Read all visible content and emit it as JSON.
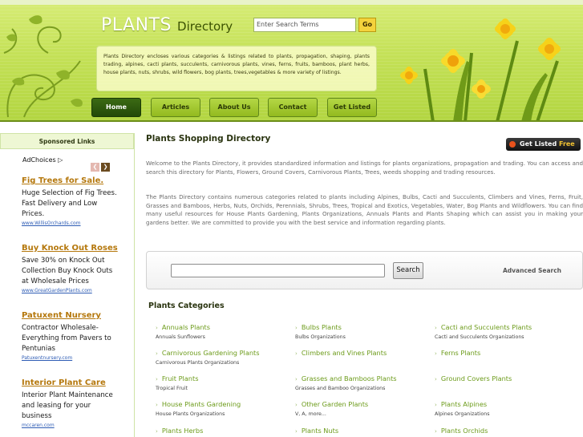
{
  "header": {
    "logo_main": "PLANTS",
    "logo_sub": "Directory",
    "search_placeholder": "Enter Search Terms",
    "search_go": "Go",
    "intro": "Plants Directory encloses various categories & listings related to plants, propagation, shaping, plants trading, alpines, cacti plants, succulents, carnivorous plants, vines, ferns, fruits, bamboos, plant herbs, house plants, nuts, shrubs, wild flowers, bog plants, trees,vegetables & more variety of listings.",
    "nav": [
      "Home",
      "Articles",
      "About Us",
      "Contact",
      "Get Listed"
    ]
  },
  "sidebar": {
    "title": "Sponsored Links",
    "adchoices": "AdChoices ▷",
    "ads": [
      {
        "title": "Fig Trees for Sale.",
        "body": "Huge Selection of Fig Trees. Fast Delivery and Low Prices.",
        "url": "www.WillisOrchards.com"
      },
      {
        "title": "Buy Knock Out Roses",
        "body": "Save 30% on Knock Out Collection Buy Knock Outs at Wholesale Prices",
        "url": "www.GreatGardenPlants.com"
      },
      {
        "title": "Patuxent Nursery",
        "body": "Contractor Wholesale- Everything from Pavers to Pentunias",
        "url": "Patuxentnursery.com"
      },
      {
        "title": "Interior Plant Care",
        "body": "Interior Plant Maintenance and leasing for your business",
        "url": "mccaren.com"
      }
    ]
  },
  "main": {
    "title": "Plants Shopping Directory",
    "get_listed": "Get Listed",
    "get_listed_free": "Free",
    "para1": "Welcome to the Plants Directory, it provides standardized information and listings for plants organizations, propagation and trading. You can access and search this directory for Plants, Flowers, Ground Covers, Carnivorous Plants, Trees, weeds shopping and trading resources.",
    "para2": "The Plants Directory contains numerous categories related to plants including Alpines, Bulbs, Cacti and Succulents, Climbers and Vines, Ferns, Fruit, Grasses and Bamboos, Herbs, Nuts, Orchids, Perennials, Shrubs, Trees, Tropical and Exotics, Vegetables, Water, Bog Plants and Wildflowers. You can find many useful resources for House Plants Gardening, Plants Organizations, Annuals Plants and Plants Shaping which can assist you in making your gardens better. We are committed to provide you with the best service and information regarding plants.",
    "search_button": "Search",
    "advanced_search": "Advanced Search",
    "categories_title": "Plants Categories",
    "categories": [
      {
        "name": "Annuals Plants",
        "sub": "Annuals Sunflowers"
      },
      {
        "name": "Bulbs Plants",
        "sub": "Bulbs Organizations"
      },
      {
        "name": "Cacti and Succulents Plants",
        "sub": "Cacti and Succulents Organizations"
      },
      {
        "name": "Carnivorous Gardening Plants",
        "sub": "Carnivorous Plants Organizations"
      },
      {
        "name": "Climbers and Vines Plants",
        "sub": ""
      },
      {
        "name": "Ferns Plants",
        "sub": ""
      },
      {
        "name": "Fruit Plants",
        "sub": "Tropical Fruit"
      },
      {
        "name": "Grasses and Bamboos Plants",
        "sub": "Grasses and Bamboo Organizations"
      },
      {
        "name": "Ground Covers Plants",
        "sub": ""
      },
      {
        "name": "House Plants Gardening",
        "sub": "House Plants Organizations"
      },
      {
        "name": "Other Garden Plants",
        "sub": "V, A, more..."
      },
      {
        "name": "Plants Alpines",
        "sub": "Alpines Organizations"
      },
      {
        "name": "Plants Herbs",
        "sub": ""
      },
      {
        "name": "Plants Nuts",
        "sub": ""
      },
      {
        "name": "Plants Orchids",
        "sub": ""
      }
    ]
  }
}
